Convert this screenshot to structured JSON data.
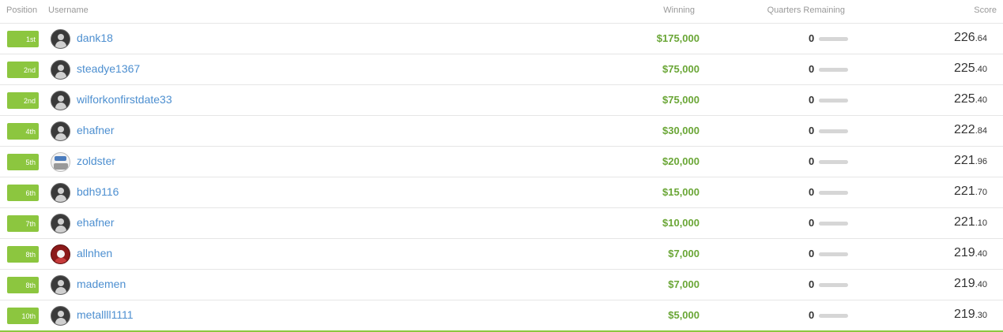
{
  "header": {
    "position": "Position",
    "username": "Username",
    "winning": "Winning",
    "quarters": "Quarters Remaining",
    "score": "Score"
  },
  "colors": {
    "badge": "#8cc63f",
    "username": "#4d8fd0",
    "winning": "#6aa636"
  },
  "rows": [
    {
      "position": "1st",
      "username": "dank18",
      "winning": "$175,000",
      "quarters": "0",
      "quarters_fraction": 0,
      "score_int": "226",
      "score_dec": ".64",
      "avatar": "default-avatar-icon"
    },
    {
      "position": "2nd",
      "username": "steadye1367",
      "winning": "$75,000",
      "quarters": "0",
      "quarters_fraction": 0,
      "score_int": "225",
      "score_dec": ".40",
      "avatar": "default-avatar-icon"
    },
    {
      "position": "2nd",
      "username": "wilforkonfirstdate33",
      "winning": "$75,000",
      "quarters": "0",
      "quarters_fraction": 0,
      "score_int": "225",
      "score_dec": ".40",
      "avatar": "default-avatar-icon"
    },
    {
      "position": "4th",
      "username": "ehafner",
      "winning": "$30,000",
      "quarters": "0",
      "quarters_fraction": 0,
      "score_int": "222",
      "score_dec": ".84",
      "avatar": "default-avatar-icon"
    },
    {
      "position": "5th",
      "username": "zoldster",
      "winning": "$20,000",
      "quarters": "0",
      "quarters_fraction": 0,
      "score_int": "221",
      "score_dec": ".96",
      "avatar": "custom-avatar-icon"
    },
    {
      "position": "6th",
      "username": "bdh9116",
      "winning": "$15,000",
      "quarters": "0",
      "quarters_fraction": 0,
      "score_int": "221",
      "score_dec": ".70",
      "avatar": "default-avatar-icon"
    },
    {
      "position": "7th",
      "username": "ehafner",
      "winning": "$10,000",
      "quarters": "0",
      "quarters_fraction": 0,
      "score_int": "221",
      "score_dec": ".10",
      "avatar": "default-avatar-icon"
    },
    {
      "position": "8th",
      "username": "allnhen",
      "winning": "$7,000",
      "quarters": "0",
      "quarters_fraction": 0,
      "score_int": "219",
      "score_dec": ".40",
      "avatar": "custom-avatar-icon"
    },
    {
      "position": "8th",
      "username": "mademen",
      "winning": "$7,000",
      "quarters": "0",
      "quarters_fraction": 0,
      "score_int": "219",
      "score_dec": ".40",
      "avatar": "default-avatar-icon"
    },
    {
      "position": "10th",
      "username": "metallll1111",
      "winning": "$5,000",
      "quarters": "0",
      "quarters_fraction": 0,
      "score_int": "219",
      "score_dec": ".30",
      "avatar": "default-avatar-icon"
    }
  ]
}
